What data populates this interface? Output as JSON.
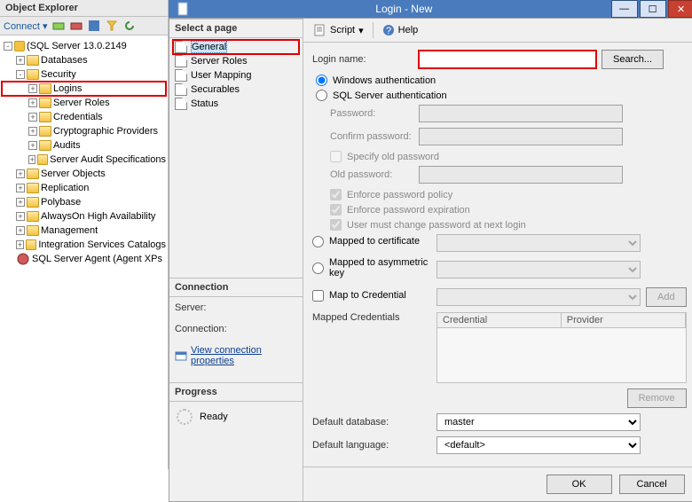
{
  "oe": {
    "title": "Object Explorer",
    "connect_label": "Connect",
    "server": "(SQL Server 13.0.2149",
    "nodes": {
      "databases": "Databases",
      "security": "Security",
      "logins": "Logins",
      "server_roles": "Server Roles",
      "credentials": "Credentials",
      "crypto_providers": "Cryptographic Providers",
      "audits": "Audits",
      "server_audit_spec": "Server Audit Specifications",
      "server_objects": "Server Objects",
      "replication": "Replication",
      "polybase": "Polybase",
      "alwayson": "AlwaysOn High Availability",
      "management": "Management",
      "isc": "Integration Services Catalogs",
      "agent": "SQL Server Agent (Agent XPs"
    }
  },
  "dlg": {
    "title": "Login - New",
    "toolbar": {
      "script": "Script",
      "help": "Help"
    },
    "pages": {
      "header": "Select a page",
      "general": "General",
      "server_roles": "Server Roles",
      "user_mapping": "User Mapping",
      "securables": "Securables",
      "status": "Status"
    },
    "connection": {
      "header": "Connection",
      "server_label": "Server:",
      "server_value": "",
      "connection_label": "Connection:",
      "connection_value": "",
      "view_props": "View connection properties"
    },
    "progress": {
      "header": "Progress",
      "state": "Ready"
    },
    "form": {
      "login_name": "Login name:",
      "login_value": "",
      "search": "Search...",
      "win_auth": "Windows authentication",
      "sql_auth": "SQL Server authentication",
      "password": "Password:",
      "confirm_password": "Confirm password:",
      "specify_old": "Specify old password",
      "old_password": "Old password:",
      "enforce_policy": "Enforce password policy",
      "enforce_expiration": "Enforce password expiration",
      "must_change": "User must change password at next login",
      "mapped_cert": "Mapped to certificate",
      "mapped_asym": "Mapped to asymmetric key",
      "map_cred": "Map to Credential",
      "add": "Add",
      "mapped_creds_label": "Mapped Credentials",
      "col_credential": "Credential",
      "col_provider": "Provider",
      "remove": "Remove",
      "default_db": "Default database:",
      "default_db_value": "master",
      "default_lang": "Default language:",
      "default_lang_value": "<default>"
    },
    "footer": {
      "ok": "OK",
      "cancel": "Cancel"
    }
  }
}
